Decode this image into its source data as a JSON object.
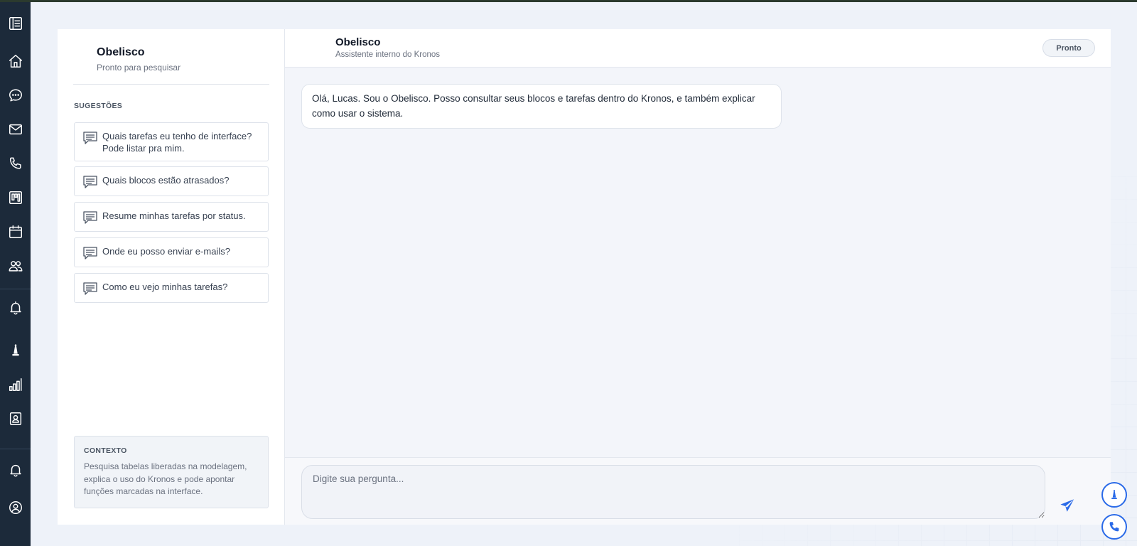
{
  "sidebar": {
    "title": "Obelisco",
    "subtitle": "Pronto para pesquisar",
    "suggestions_label": "SUGESTÕES",
    "suggestions": [
      {
        "text": "Quais tarefas eu tenho de interface? Pode listar pra mim."
      },
      {
        "text": "Quais blocos estão atrasados?"
      },
      {
        "text": "Resume minhas tarefas por status."
      },
      {
        "text": "Onde eu posso enviar e-mails?"
      },
      {
        "text": "Como eu vejo minhas tarefas?"
      }
    ],
    "context": {
      "label": "CONTEXTO",
      "text": "Pesquisa tabelas liberadas na modelagem, explica o uso do Kronos e pode apontar funções marcadas na interface."
    }
  },
  "chat": {
    "title": "Obelisco",
    "subtitle": "Assistente interno do Kronos",
    "status": "Pronto",
    "messages": [
      {
        "role": "assistant",
        "text": "Olá, Lucas. Sou o Obelisco. Posso consultar seus blocos e tarefas dentro do Kronos, e também explicar como usar o sistema."
      }
    ],
    "input_value": "",
    "input_placeholder": "Digite sua pergunta..."
  },
  "nav_icons": [
    "sidebar-toggle-icon",
    "home-icon",
    "chat-icon",
    "mail-icon",
    "phone-icon",
    "kanban-icon",
    "calendar-icon",
    "users-icon",
    "bell-icon",
    "obelisk-icon",
    "chart-icon",
    "contact-card-icon",
    "notification-bell-icon",
    "user-profile-icon"
  ],
  "colors": {
    "rail": "#1c2a3a",
    "accent": "#2a6ae8",
    "background": "#eef2f9"
  }
}
